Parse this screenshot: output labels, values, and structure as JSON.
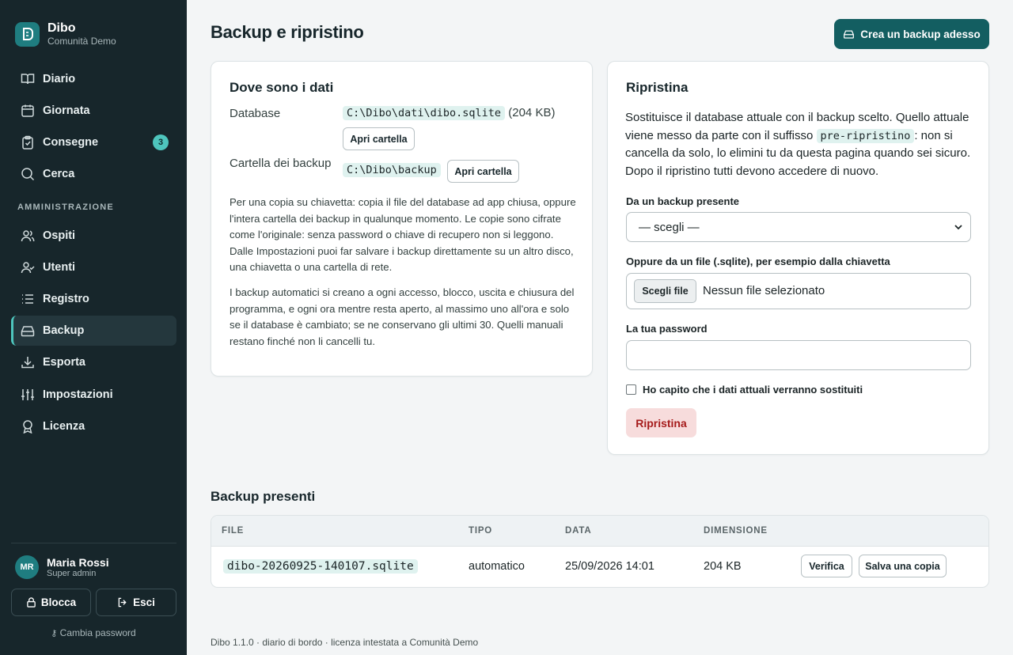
{
  "brand": {
    "name": "Dibo",
    "subtitle": "Comunità Demo"
  },
  "nav": {
    "items": [
      {
        "label": "Diario",
        "icon": "book-icon"
      },
      {
        "label": "Giornata",
        "icon": "calendar-icon"
      },
      {
        "label": "Consegne",
        "icon": "clipboard-icon",
        "badge": "3"
      },
      {
        "label": "Cerca",
        "icon": "search-icon"
      }
    ],
    "admin_title": "AMMINISTRAZIONE",
    "admin_items": [
      {
        "label": "Ospiti",
        "icon": "users-icon"
      },
      {
        "label": "Utenti",
        "icon": "user-check-icon"
      },
      {
        "label": "Registro",
        "icon": "list-icon"
      },
      {
        "label": "Backup",
        "icon": "hard-drive-icon",
        "active": true
      },
      {
        "label": "Esporta",
        "icon": "download-icon"
      },
      {
        "label": "Impostazioni",
        "icon": "sliders-icon"
      },
      {
        "label": "Licenza",
        "icon": "award-icon"
      }
    ]
  },
  "user": {
    "initials": "MR",
    "name": "Maria Rossi",
    "role": "Super admin"
  },
  "side_buttons": {
    "lock": "Blocca",
    "logout": "Esci",
    "change_password": "Cambia password"
  },
  "header": {
    "title": "Backup e ripristino",
    "create_backup": "Crea un backup adesso"
  },
  "data_card": {
    "title": "Dove sono i dati",
    "db_label": "Database",
    "db_path": "C:\\Dibo\\dati\\dibo.sqlite",
    "db_size": "(204 KB)",
    "open_folder": "Apri cartella",
    "backup_folder_label": "Cartella dei backup",
    "backup_path": "C:\\Dibo\\backup",
    "para1": "Per una copia su chiavetta: copia il file del database ad app chiusa, oppure l'intera cartella dei backup in qualunque momento. Le copie sono cifrate come l'originale: senza password o chiave di recupero non si leggono. Dalle Impostazioni puoi far salvare i backup direttamente su un altro disco, una chiavetta o una cartella di rete.",
    "para2": "I backup automatici si creano a ogni accesso, blocco, uscita e chiusura del programma, e ogni ora mentre resta aperto, al massimo uno all'ora e solo se il database è cambiato; se ne conservano gli ultimi 30. Quelli manuali restano finché non li cancelli tu."
  },
  "restore_card": {
    "title": "Ripristina",
    "desc_before": "Sostituisce il database attuale con il backup scelto. Quello attuale viene messo da parte con il suffisso ",
    "desc_code": "pre-ripristino",
    "desc_after": ": non si cancella da solo, lo elimini tu da questa pagina quando sei sicuro. Dopo il ripristino tutti devono accedere di nuovo.",
    "existing_label": "Da un backup presente",
    "select_value": "— scegli —",
    "file_label": "Oppure da un file (.sqlite), per esempio dalla chiavetta",
    "file_button": "Scegli file",
    "file_status": "Nessun file selezionato",
    "password_label": "La tua password",
    "confirm_label": "Ho capito che i dati attuali verranno sostituiti",
    "restore_button": "Ripristina"
  },
  "backups": {
    "title": "Backup presenti",
    "columns": [
      "FILE",
      "TIPO",
      "DATA",
      "DIMENSIONE"
    ],
    "rows": [
      {
        "file": "dibo-20260925-140107.sqlite",
        "type": "automatico",
        "date": "25/09/2026 14:01",
        "size": "204 KB",
        "verify": "Verifica",
        "save_copy": "Salva una copia"
      }
    ]
  },
  "footer": "Dibo 1.1.0 · diario di bordo · licenza intestata a Comunità Demo",
  "colors": {
    "sidebar": "#17262b",
    "accent": "#135e61",
    "teal": "#4ec5bd",
    "danger_bg": "#f7dcdc",
    "danger_text": "#a61b1b"
  }
}
